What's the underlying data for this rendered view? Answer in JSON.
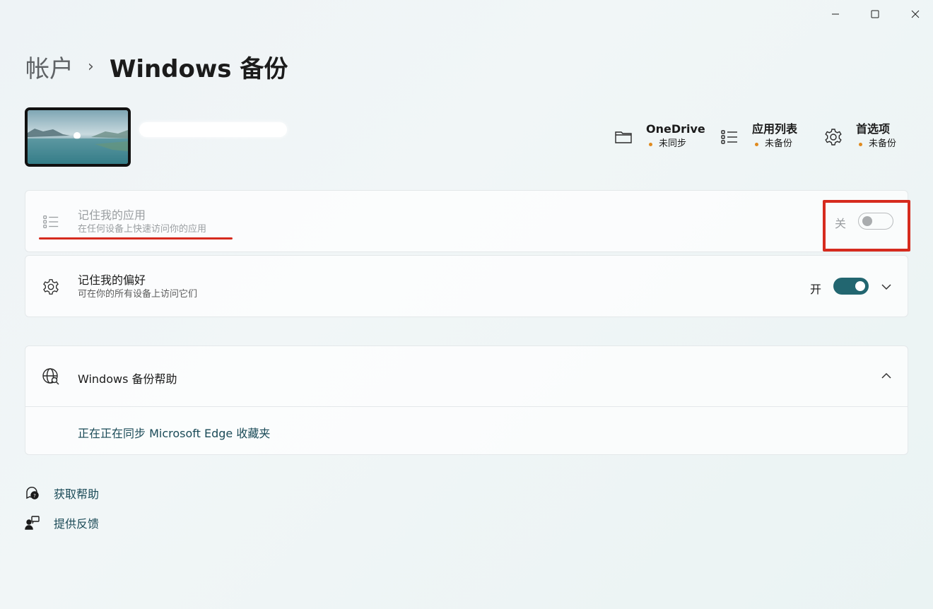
{
  "window": {
    "minimize_icon": "minimize-icon",
    "maximize_icon": "maximize-icon",
    "close_icon": "close-icon"
  },
  "breadcrumb": {
    "parent": "帐户",
    "separator": "›",
    "current": "Windows 备份"
  },
  "account": {
    "avatar": "landscape-avatar"
  },
  "status": {
    "onedrive": {
      "title": "OneDrive",
      "state": "未同步",
      "icon": "folder-icon"
    },
    "apps": {
      "title": "应用列表",
      "state": "未备份",
      "icon": "list-icon"
    },
    "prefs": {
      "title": "首选项",
      "state": "未备份",
      "icon": "gear-icon"
    },
    "dot_color": "#e08a1e"
  },
  "settings": {
    "remember_apps": {
      "title": "记住我的应用",
      "subtitle": "在任何设备上快速访问你的应用",
      "toggle_label": "关",
      "toggle_on": false
    },
    "remember_prefs": {
      "title": "记住我的偏好",
      "subtitle": "可在你的所有设备上访问它们",
      "toggle_label": "开",
      "toggle_on": true
    }
  },
  "help": {
    "title": "Windows 备份帮助",
    "link": "正在正在同步 Microsoft Edge 收藏夹"
  },
  "footer": {
    "get_help": "获取帮助",
    "feedback": "提供反馈"
  },
  "colors": {
    "accent": "#226670",
    "annotation_red": "#d62b1e"
  }
}
